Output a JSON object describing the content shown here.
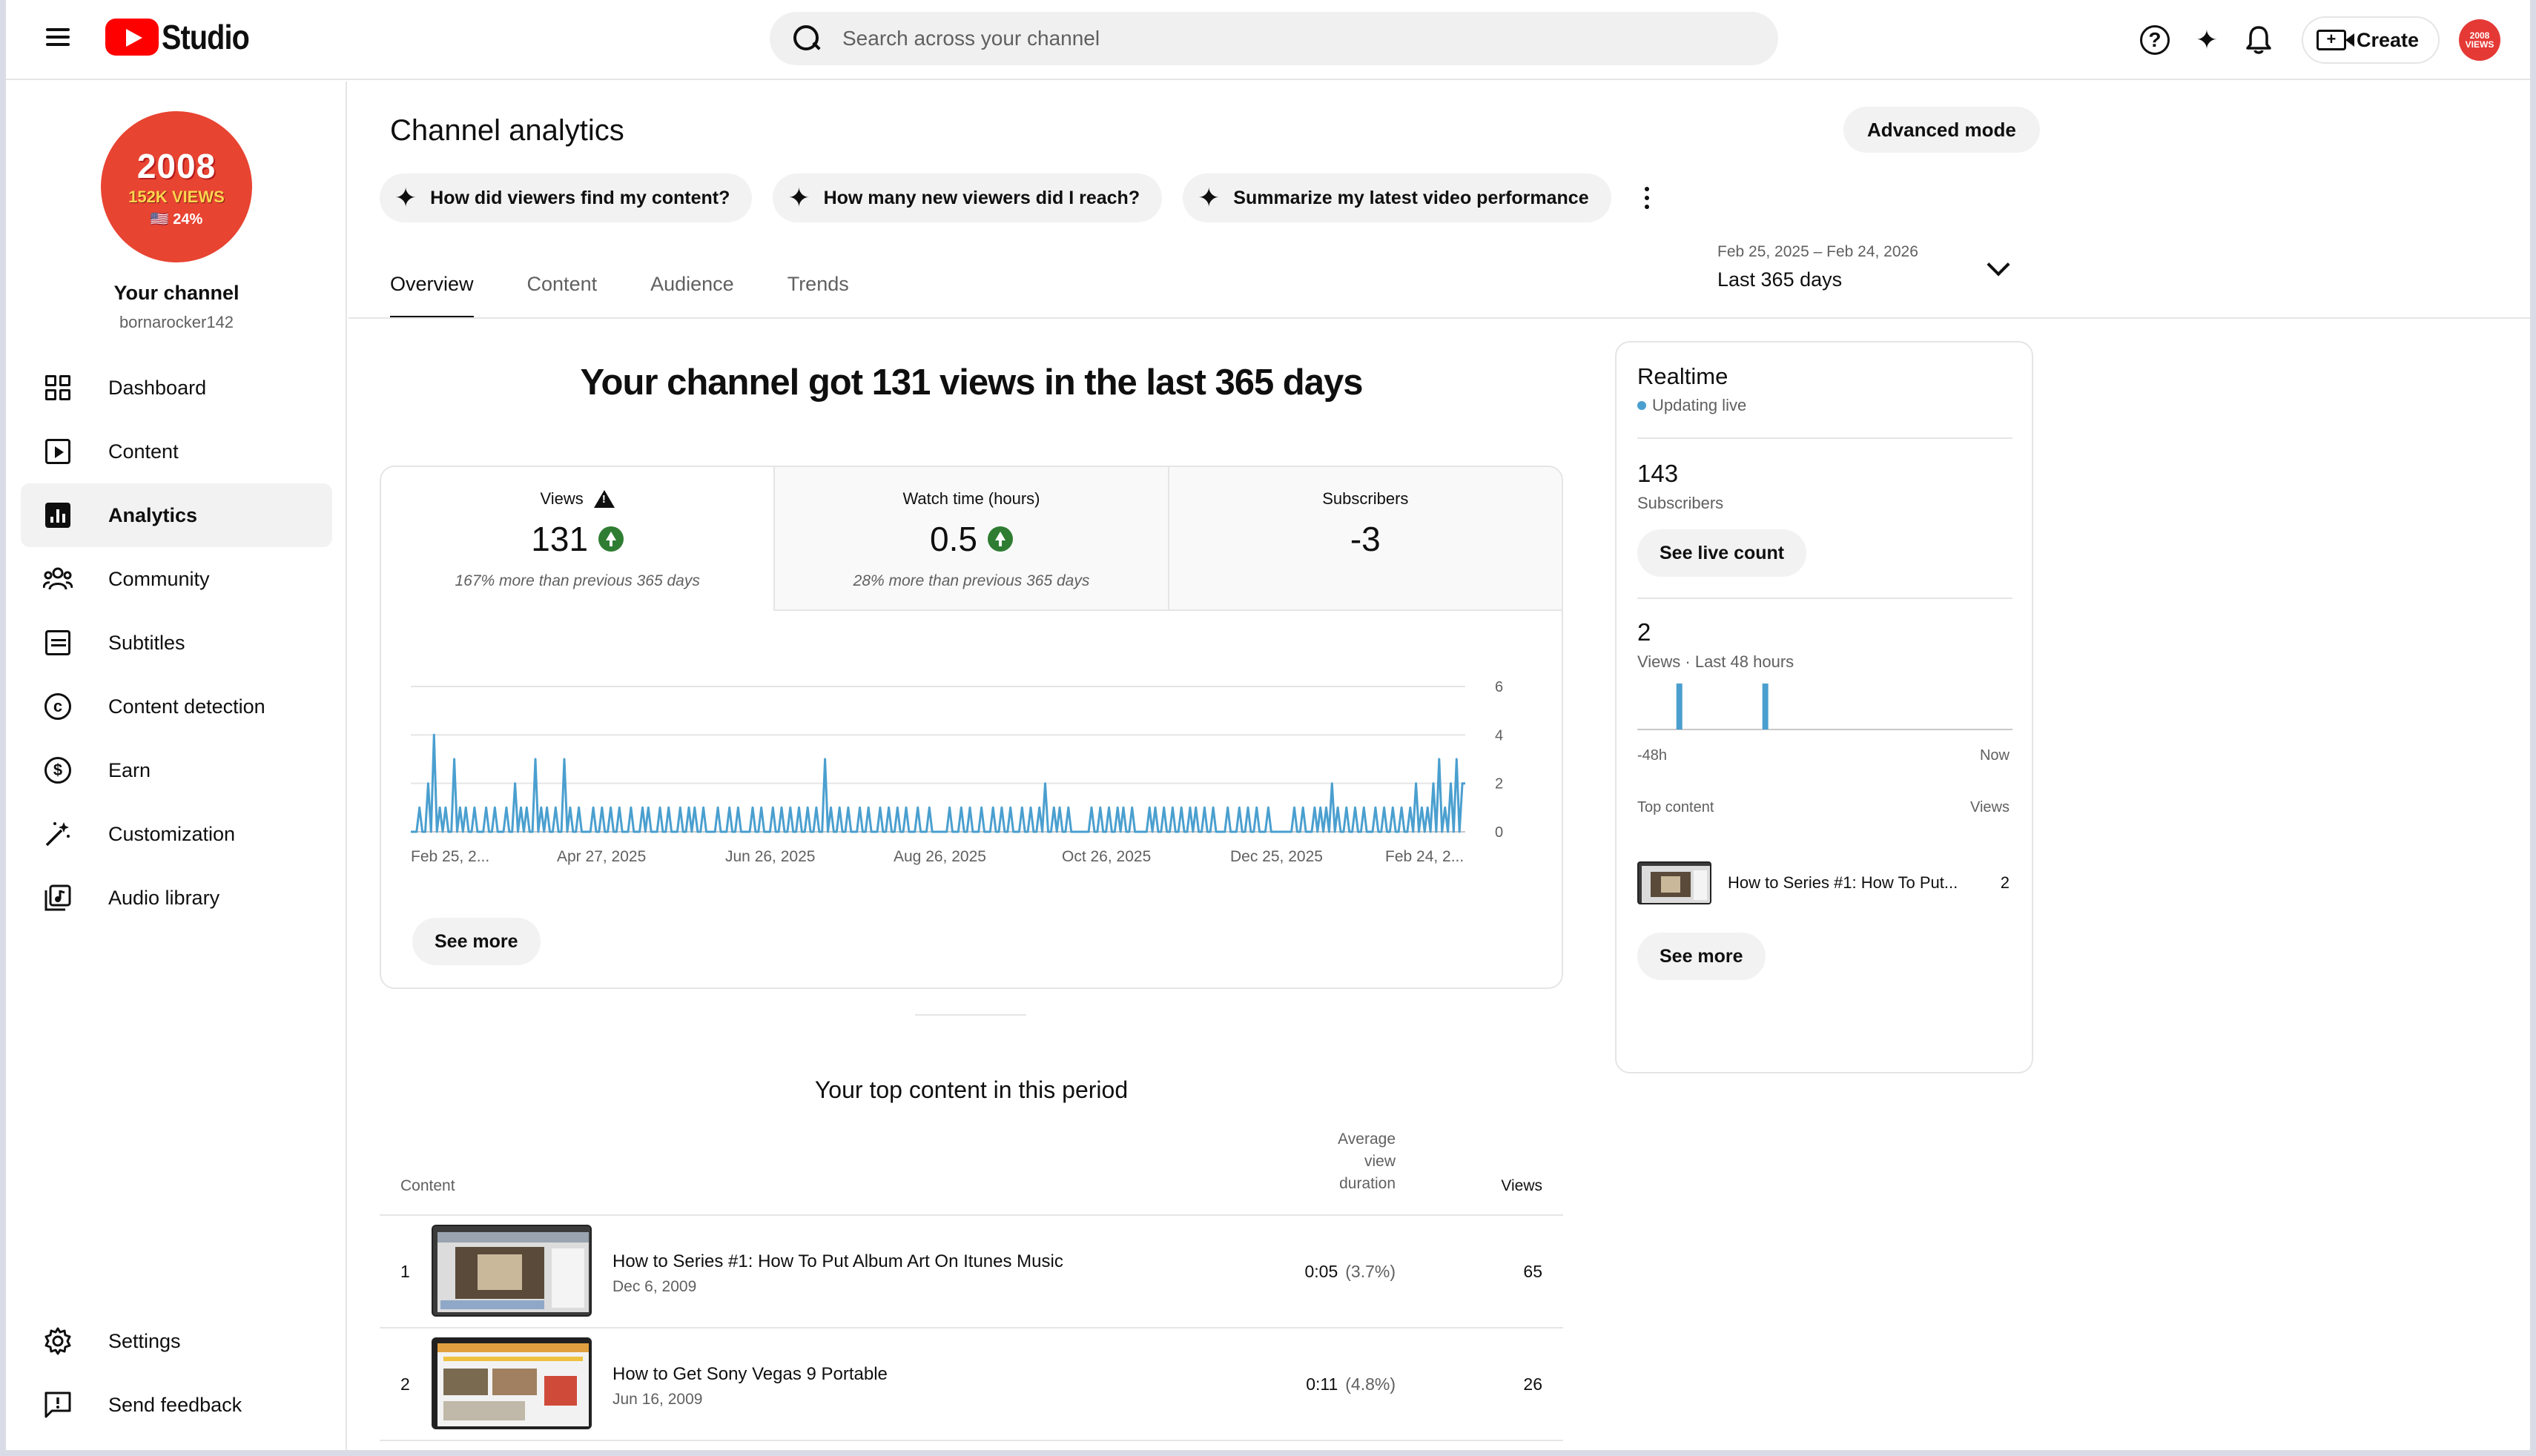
{
  "header": {
    "app_name": "Studio",
    "search_placeholder": "Search across your channel",
    "create_label": "Create"
  },
  "sidebar": {
    "channel_name": "Your channel",
    "channel_handle": "bornarocker142",
    "avatar": {
      "line1": "2008",
      "line2": "152K VIEWS",
      "line3": "🇺🇸 24%"
    },
    "items": [
      {
        "label": "Dashboard",
        "icon": "dashboard-icon"
      },
      {
        "label": "Content",
        "icon": "content-icon"
      },
      {
        "label": "Analytics",
        "icon": "analytics-icon",
        "active": true
      },
      {
        "label": "Community",
        "icon": "community-icon"
      },
      {
        "label": "Subtitles",
        "icon": "subtitles-icon"
      },
      {
        "label": "Content detection",
        "icon": "copyright-icon"
      },
      {
        "label": "Earn",
        "icon": "dollar-icon"
      },
      {
        "label": "Customization",
        "icon": "magic-wand-icon"
      },
      {
        "label": "Audio library",
        "icon": "audio-library-icon"
      }
    ],
    "bottom_items": [
      {
        "label": "Settings",
        "icon": "gear-icon"
      },
      {
        "label": "Send feedback",
        "icon": "feedback-icon"
      }
    ]
  },
  "main": {
    "title": "Channel analytics",
    "advanced_mode": "Advanced mode",
    "chips": [
      "How did viewers find my content?",
      "How many new viewers did I reach?",
      "Summarize my latest video performance"
    ],
    "tabs": [
      "Overview",
      "Content",
      "Audience",
      "Trends"
    ],
    "date_range": {
      "range": "Feb 25, 2025 – Feb 24, 2026",
      "label": "Last 365 days"
    },
    "headline": "Your channel got 131 views in the last 365 days",
    "metrics": [
      {
        "label": "Views",
        "value": "131",
        "note": "167% more than previous 365 days"
      },
      {
        "label": "Watch time (hours)",
        "value": "0.5",
        "note": "28% more than previous 365 days"
      },
      {
        "label": "Subscribers",
        "value": "-3",
        "note": ""
      }
    ],
    "see_more": "See more",
    "top_content_title": "Your top content in this period",
    "table": {
      "col_content": "Content",
      "col_avg": "Average view duration",
      "col_views": "Views",
      "rows": [
        {
          "rank": "1",
          "title": "How to Series #1: How To Put Album Art On Itunes Music",
          "date": "Dec 6, 2009",
          "avg": "0:05",
          "pct": "(3.7%)",
          "views": "65"
        },
        {
          "rank": "2",
          "title": "How to Get Sony Vegas 9 Portable",
          "date": "Jun 16, 2009",
          "avg": "0:11",
          "pct": "(4.8%)",
          "views": "26"
        }
      ]
    }
  },
  "chart_data": {
    "type": "line",
    "x_labels": [
      "Feb 25, 2...",
      "Apr 27, 2025",
      "Jun 26, 2025",
      "Aug 26, 2025",
      "Oct 26, 2025",
      "Dec 25, 2025",
      "Feb 24, 2..."
    ],
    "y_ticks": [
      "0",
      "2",
      "4",
      "6"
    ],
    "ylim": [
      0,
      6
    ],
    "color": "#4a9fcf",
    "spikes": [
      [
        3,
        1
      ],
      [
        6,
        2
      ],
      [
        8,
        4
      ],
      [
        10,
        1
      ],
      [
        12,
        1
      ],
      [
        15,
        3
      ],
      [
        17,
        1
      ],
      [
        19,
        1
      ],
      [
        22,
        1
      ],
      [
        26,
        1
      ],
      [
        29,
        1
      ],
      [
        33,
        1
      ],
      [
        36,
        2
      ],
      [
        38,
        1
      ],
      [
        40,
        1
      ],
      [
        43,
        3
      ],
      [
        45,
        1
      ],
      [
        47,
        1
      ],
      [
        50,
        1
      ],
      [
        53,
        3
      ],
      [
        55,
        1
      ],
      [
        58,
        1
      ],
      [
        63,
        1
      ],
      [
        66,
        1
      ],
      [
        69,
        1
      ],
      [
        72,
        1
      ],
      [
        76,
        1
      ],
      [
        80,
        1
      ],
      [
        82,
        1
      ],
      [
        86,
        1
      ],
      [
        89,
        1
      ],
      [
        93,
        1
      ],
      [
        96,
        1
      ],
      [
        98,
        1
      ],
      [
        101,
        1
      ],
      [
        106,
        1
      ],
      [
        110,
        1
      ],
      [
        113,
        1
      ],
      [
        118,
        1
      ],
      [
        121,
        1
      ],
      [
        125,
        1
      ],
      [
        128,
        1
      ],
      [
        131,
        1
      ],
      [
        134,
        1
      ],
      [
        137,
        1
      ],
      [
        140,
        1
      ],
      [
        143,
        3
      ],
      [
        145,
        1
      ],
      [
        148,
        1
      ],
      [
        151,
        1
      ],
      [
        155,
        1
      ],
      [
        158,
        1
      ],
      [
        162,
        1
      ],
      [
        165,
        1
      ],
      [
        168,
        1
      ],
      [
        171,
        1
      ],
      [
        175,
        1
      ],
      [
        179,
        1
      ],
      [
        186,
        1
      ],
      [
        190,
        1
      ],
      [
        193,
        1
      ],
      [
        197,
        1
      ],
      [
        201,
        1
      ],
      [
        204,
        1
      ],
      [
        207,
        1
      ],
      [
        211,
        1
      ],
      [
        214,
        1
      ],
      [
        217,
        1
      ],
      [
        219,
        2
      ],
      [
        222,
        1
      ],
      [
        224,
        1
      ],
      [
        227,
        1
      ],
      [
        235,
        1
      ],
      [
        238,
        1
      ],
      [
        241,
        1
      ],
      [
        244,
        1
      ],
      [
        246,
        1
      ],
      [
        249,
        1
      ],
      [
        255,
        1
      ],
      [
        257,
        1
      ],
      [
        260,
        1
      ],
      [
        263,
        1
      ],
      [
        266,
        1
      ],
      [
        269,
        1
      ],
      [
        271,
        1
      ],
      [
        274,
        1
      ],
      [
        277,
        1
      ],
      [
        282,
        1
      ],
      [
        286,
        1
      ],
      [
        289,
        1
      ],
      [
        292,
        1
      ],
      [
        296,
        1
      ],
      [
        305,
        1
      ],
      [
        308,
        1
      ],
      [
        312,
        1
      ],
      [
        314,
        1
      ],
      [
        316,
        1
      ],
      [
        318,
        2
      ],
      [
        320,
        1
      ],
      [
        323,
        1
      ],
      [
        326,
        1
      ],
      [
        329,
        1
      ],
      [
        333,
        1
      ],
      [
        336,
        1
      ],
      [
        339,
        1
      ],
      [
        342,
        1
      ],
      [
        345,
        1
      ],
      [
        347,
        2
      ],
      [
        349,
        1
      ],
      [
        351,
        1
      ],
      [
        353,
        2
      ],
      [
        355,
        3
      ],
      [
        357,
        1
      ],
      [
        359,
        2
      ],
      [
        361,
        3
      ],
      [
        363,
        2
      ],
      [
        364,
        2
      ]
    ]
  },
  "realtime": {
    "title": "Realtime",
    "live": "Updating live",
    "subs_value": "143",
    "subs_label": "Subscribers",
    "see_live": "See live count",
    "views_value": "2",
    "views_label": "Views · Last 48 hours",
    "axis_start": "-48h",
    "axis_end": "Now",
    "top_content": "Top content",
    "views_col": "Views",
    "top_video_title": "How to Series #1: How To Put...",
    "top_video_views": "2",
    "see_more": "See more",
    "bars": [
      {
        "hour": 5,
        "value": 1
      },
      {
        "hour": 16,
        "value": 1
      }
    ]
  }
}
